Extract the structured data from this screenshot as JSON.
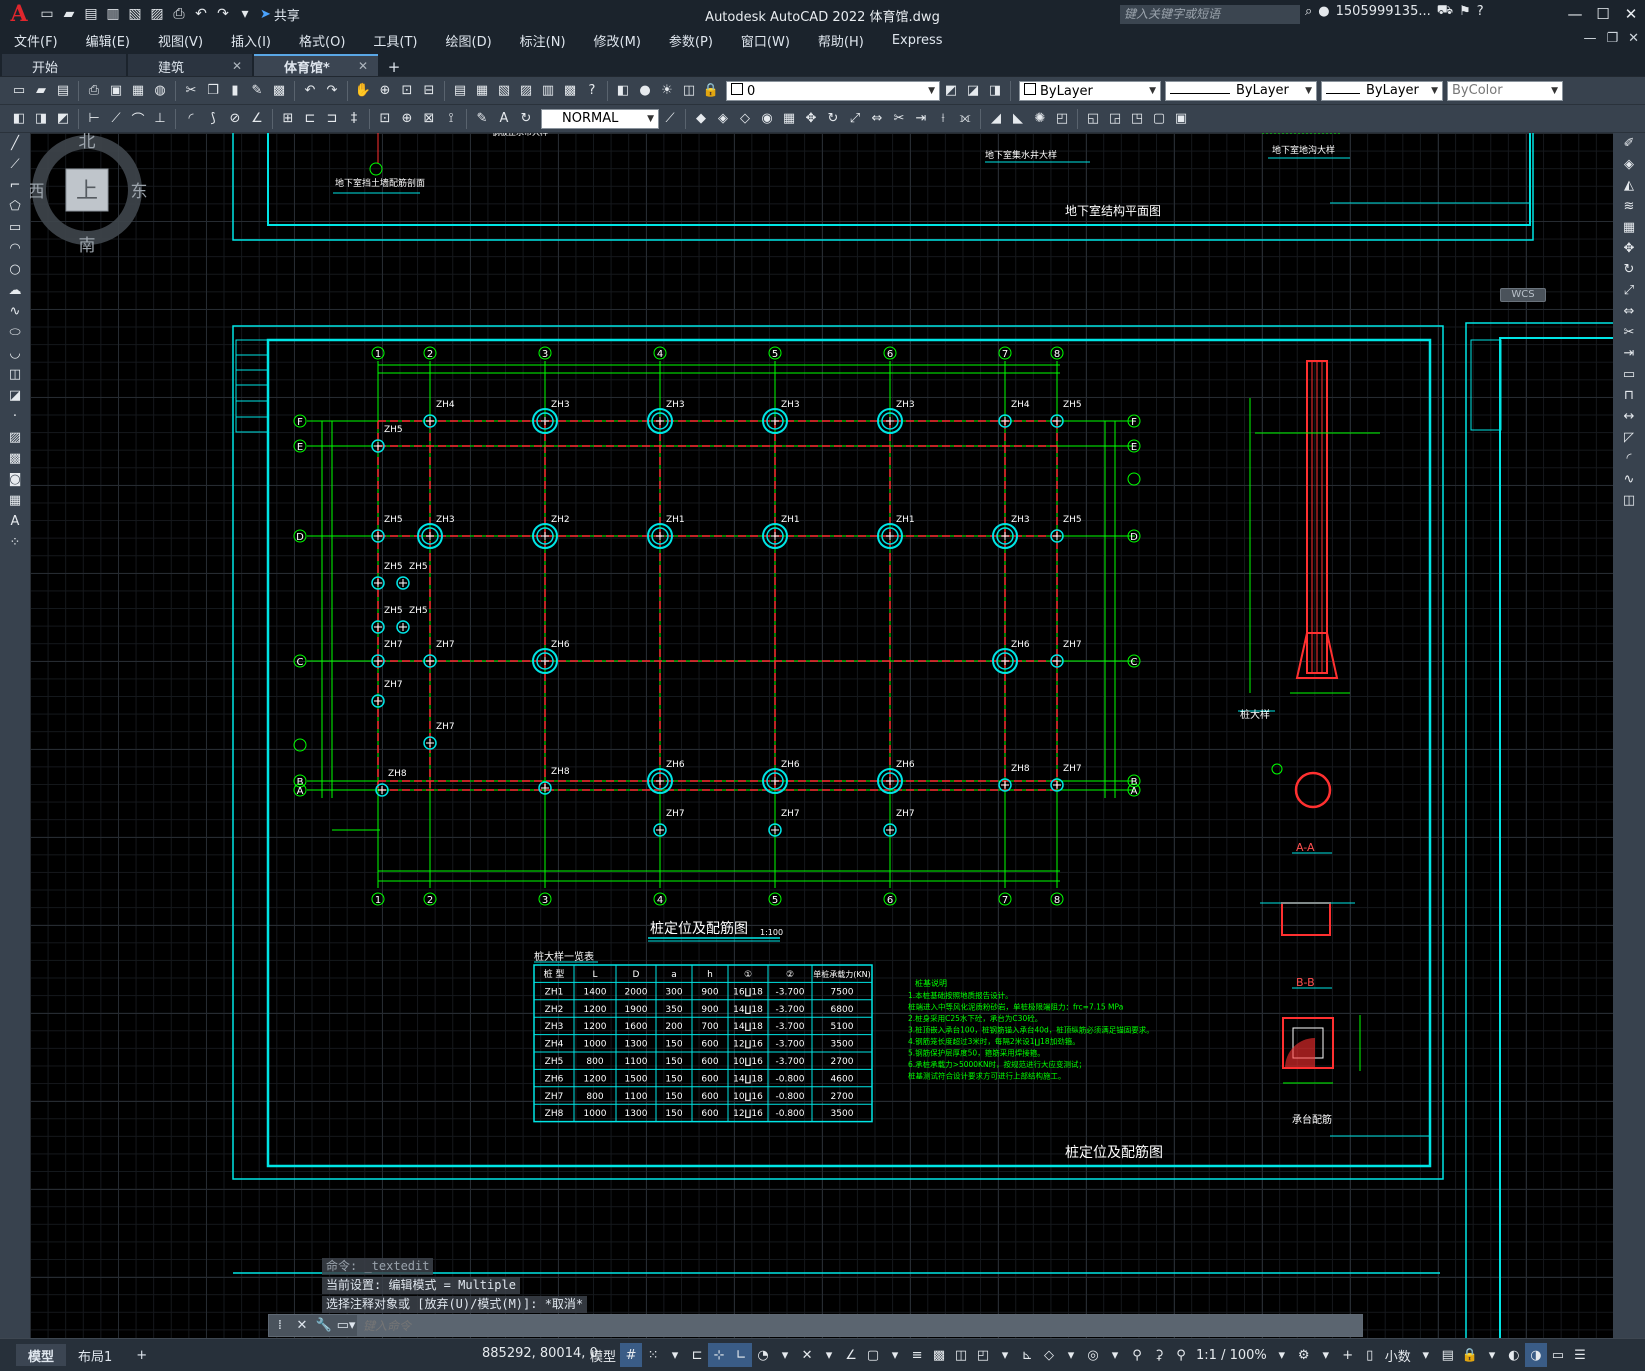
{
  "window": {
    "title": "Autodesk AutoCAD 2022    体育馆.dwg",
    "app_logo": "A",
    "share_label": "共享",
    "search_placeholder": "键入关键字或短语",
    "user": "1505999135...",
    "icons": [
      "new-icon",
      "open-icon",
      "save-icon",
      "save-as-icon",
      "publish-icon",
      "print-icon",
      "undo-icon",
      "redo-icon"
    ]
  },
  "menubar": {
    "items": [
      "文件(F)",
      "编辑(E)",
      "视图(V)",
      "插入(I)",
      "格式(O)",
      "工具(T)",
      "绘图(D)",
      "标注(N)",
      "修改(M)",
      "参数(P)",
      "窗口(W)",
      "帮助(H)",
      "Express"
    ]
  },
  "tabs": [
    {
      "label": "开始",
      "closable": false
    },
    {
      "label": "建筑",
      "closable": true
    },
    {
      "label": "体育馆*",
      "closable": true,
      "active": true
    }
  ],
  "toolbar": {
    "layer_value": "0",
    "color_value": "ByLayer",
    "linetype_value": "ByLayer",
    "lineweight_value": "ByLayer",
    "plotstyle_value": "ByColor",
    "textstyle_value": "NORMAL"
  },
  "viewcube": {
    "north": "北",
    "south": "南",
    "east": "东",
    "west": "西",
    "top": "上",
    "wcs": "WCS"
  },
  "drawing": {
    "top_sheet": {
      "title": "地下室结构平面图",
      "labels": [
        "地下室挡土墙配筋剖面",
        "钢板止水带大样",
        "地下室集水井大样",
        "地下室地沟大样"
      ]
    },
    "main_sheet": {
      "title": "桩定位及配筋图",
      "plan_title": "桩定位及配筋图",
      "plan_scale": "1:100",
      "axes_top": [
        "1",
        "2",
        "3",
        "4",
        "5",
        "6",
        "7",
        "8"
      ],
      "axes_side": [
        "F",
        "E",
        "D",
        "C",
        "B",
        "A"
      ],
      "pile_detail_title": "桩大样",
      "section_aa": "A-A",
      "section_bb": "B-B",
      "cap_title": "承台配筋",
      "table_title": "桩大样一览表",
      "table_headers": [
        "桩 型",
        "L",
        "D",
        "a",
        "h",
        "①",
        "②",
        "单桩承载力(KN)"
      ],
      "table_rows": [
        [
          "ZH1",
          "1400",
          "2000",
          "300",
          "900",
          "16∐18",
          "-3.700",
          "7500"
        ],
        [
          "ZH2",
          "1200",
          "1900",
          "350",
          "900",
          "14∐18",
          "-3.700",
          "6800"
        ],
        [
          "ZH3",
          "1200",
          "1600",
          "200",
          "700",
          "14∐18",
          "-3.700",
          "5100"
        ],
        [
          "ZH4",
          "1000",
          "1300",
          "150",
          "600",
          "12∐16",
          "-3.700",
          "3500"
        ],
        [
          "ZH5",
          "800",
          "1100",
          "150",
          "600",
          "10∐16",
          "-3.700",
          "2700"
        ],
        [
          "ZH6",
          "1200",
          "1500",
          "150",
          "600",
          "14∐18",
          "-0.800",
          "4600"
        ],
        [
          "ZH7",
          "800",
          "1100",
          "150",
          "600",
          "10∐16",
          "-0.800",
          "2700"
        ],
        [
          "ZH8",
          "1000",
          "1300",
          "150",
          "600",
          "12∐16",
          "-0.800",
          "3500"
        ]
      ],
      "notes_title": "桩基说明",
      "notes": [
        "1.本桩基础按照地质报告设计。",
        "  桩端进入中等风化泥质粉砂岩，单桩极限端阻力：frc=7.15 MPa",
        "2.桩身采用C25水下砼，承台为C30砼。",
        "3.桩顶嵌入承台100，桩钢筋锚入承台40d，桩顶纵筋必须满足锚固要求。",
        "4.钢筋笼长度超过3米时，每隔2米设1∐18加劲箍。",
        "5.钢筋保护层厚度50，箍筋采用焊接箍。",
        "6.承桩承载力>5000KN时，按规范进行大应变测试；",
        "  桩基测试符合设计要求方可进行上部结构施工。"
      ]
    }
  },
  "command": {
    "history": [
      "命令: _textedit",
      "当前设置: 编辑模式 = Multiple",
      "选择注释对象或 [放弃(U)/模式(M)]: *取消*"
    ],
    "placeholder": "键入命令"
  },
  "status": {
    "layout_tabs": [
      "模型",
      "布局1"
    ],
    "coords": "885292, 80014, 0",
    "model_label": "模型",
    "scale": "1:1 / 100%",
    "units": "小数"
  }
}
